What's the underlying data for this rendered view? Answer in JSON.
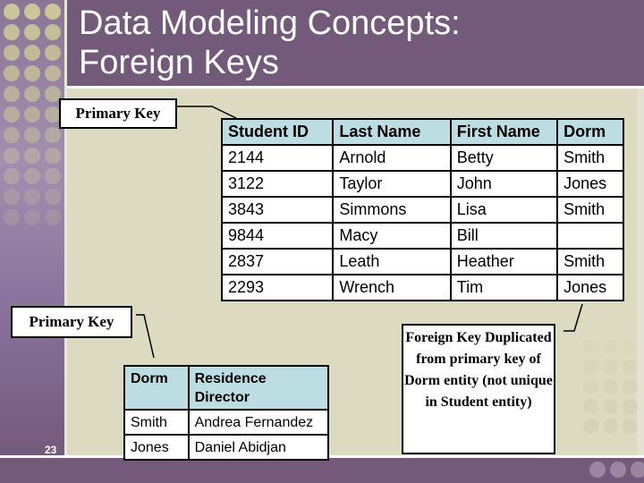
{
  "slide": {
    "title": "Data Modeling Concepts:\nForeign Keys",
    "slide_number": "23",
    "colors": {
      "header": "#735a7a",
      "content_bg": "#dcdac0",
      "table_header_bg": "#bcdde2",
      "dot": "#c9c69a"
    }
  },
  "callouts": {
    "primary_key_student": "Primary Key",
    "primary_key_dorm": "Primary Key",
    "foreign_key": "Foreign Key Duplicated from primary key of Dorm entity (not unique in Student entity)"
  },
  "student_table": {
    "headers": [
      "Student ID",
      "Last Name",
      "First Name",
      "Dorm"
    ],
    "rows": [
      [
        "2144",
        "Arnold",
        "Betty",
        "Smith"
      ],
      [
        "3122",
        "Taylor",
        "John",
        "Jones"
      ],
      [
        "3843",
        "Simmons",
        "Lisa",
        "Smith"
      ],
      [
        "9844",
        "Macy",
        "Bill",
        ""
      ],
      [
        "2837",
        "Leath",
        "Heather",
        "Smith"
      ],
      [
        "2293",
        "Wrench",
        "Tim",
        "Jones"
      ]
    ]
  },
  "dorm_table": {
    "headers": [
      "Dorm",
      "Residence Director"
    ],
    "rows": [
      [
        "Smith",
        "Andrea Fernandez"
      ],
      [
        "Jones",
        "Daniel Abidjan"
      ]
    ]
  }
}
